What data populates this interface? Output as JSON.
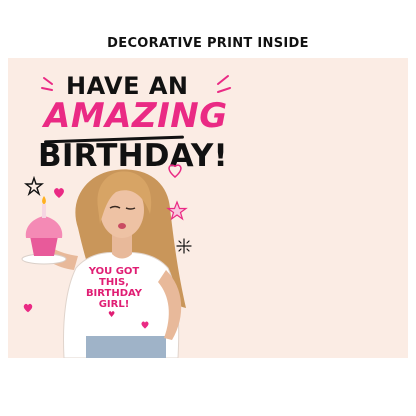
{
  "header": {
    "title": "DECORATIVE PRINT INSIDE"
  },
  "card": {
    "headline": {
      "line1": "HAVE AN",
      "line2": "AMAZING",
      "line3": "BIRTHDAY!"
    },
    "shirt_text": [
      "YOU GOT",
      "THIS,",
      "BIRTHDAY",
      "GIRL!"
    ],
    "colors": {
      "background": "#fbece4",
      "accent_pink": "#ea2a84",
      "ink": "#111111",
      "hair": "#c9965a",
      "skin": "#e8b99a",
      "shirt": "#ffffff",
      "jeans": "#9fb3c8",
      "cupcake_frosting": "#f48ab5",
      "cupcake_liner": "#e85a9a"
    },
    "icons": [
      "star-outline-icon",
      "heart-icon",
      "sparkle-icon",
      "star-pink-icon",
      "heart-small-icon"
    ]
  }
}
